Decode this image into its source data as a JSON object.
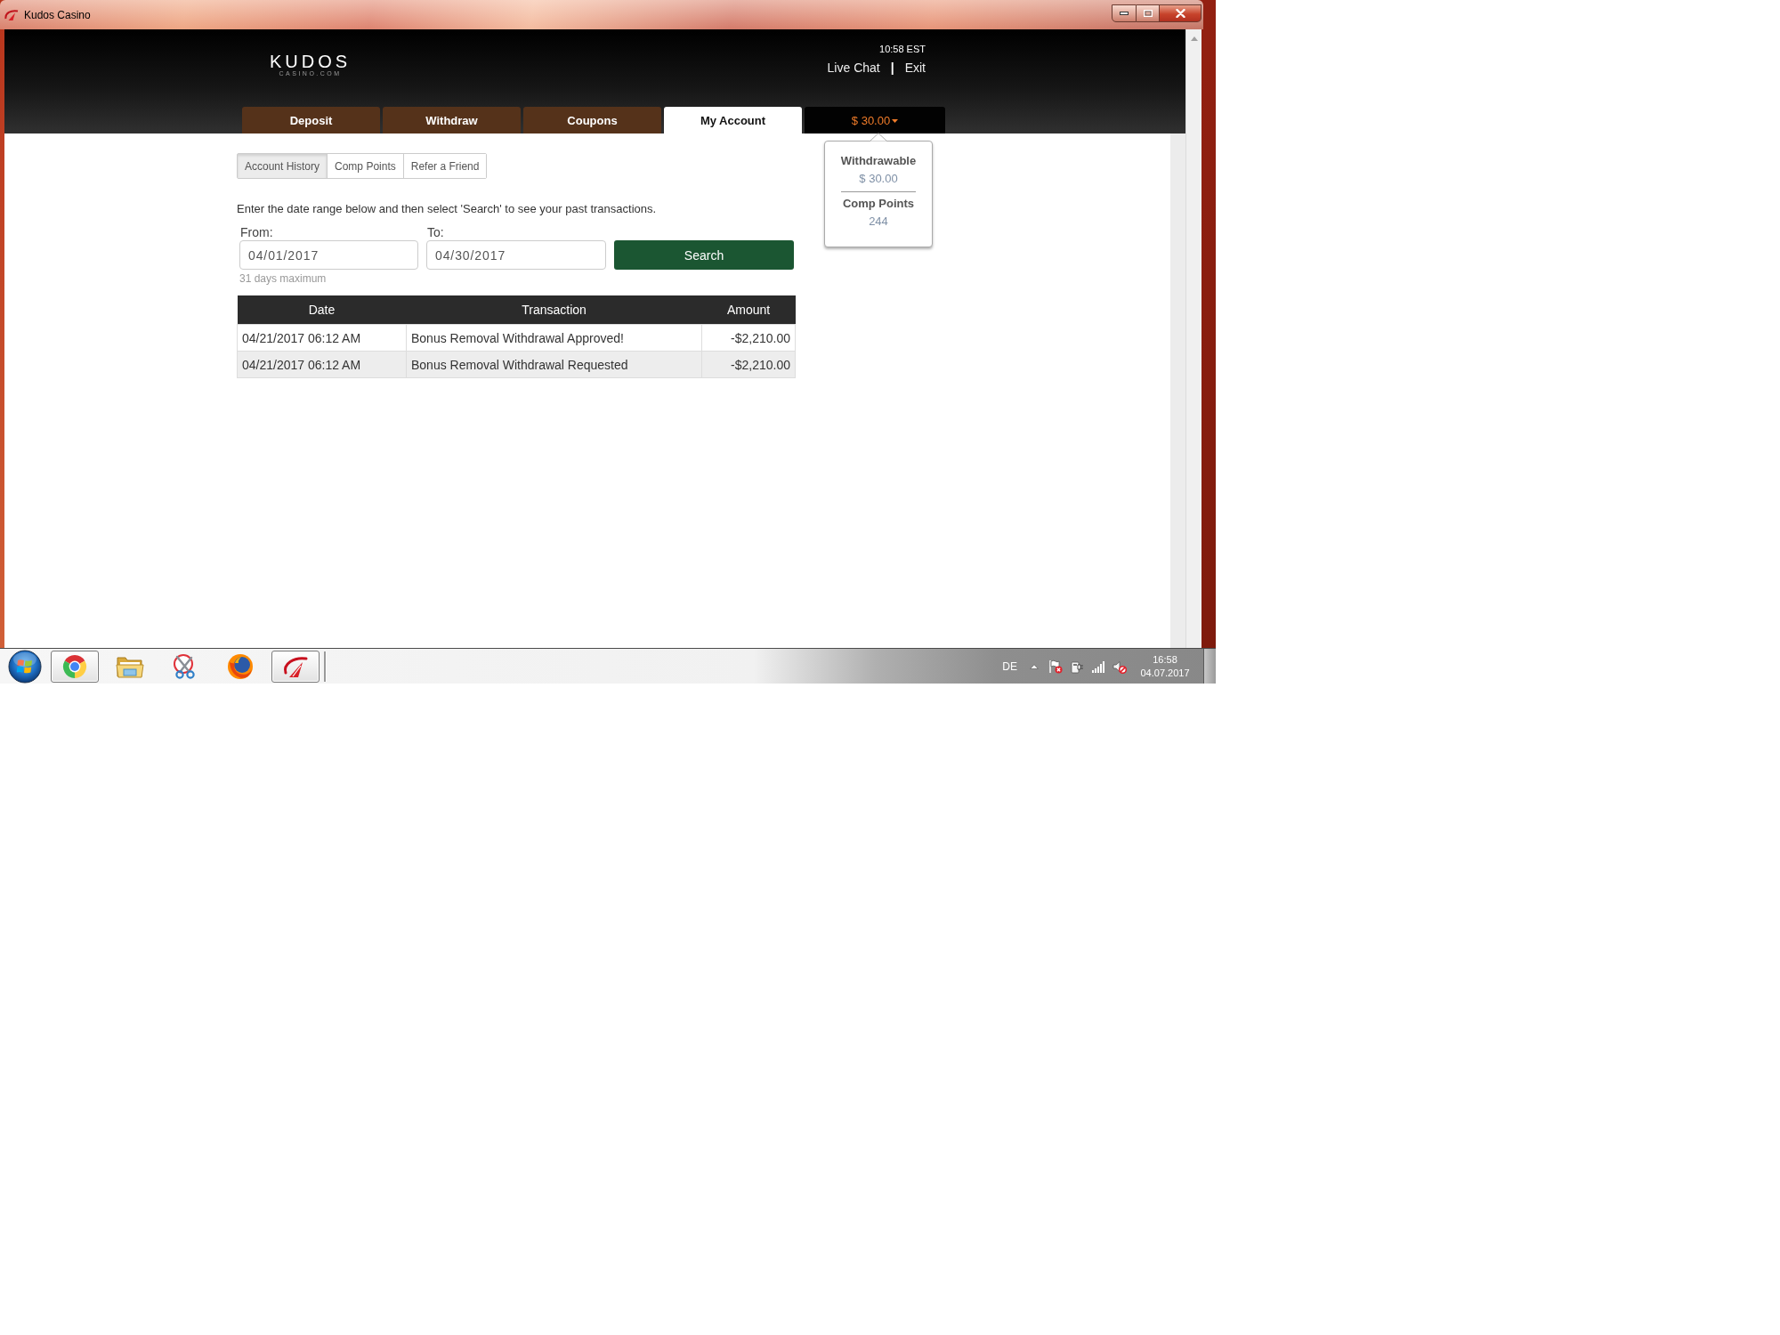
{
  "window": {
    "title": "Kudos Casino"
  },
  "header": {
    "logo": {
      "name": "KUDOS",
      "tagline": "CASINO.COM"
    },
    "clock": "10:58 EST",
    "links": [
      "Live Chat",
      "Exit"
    ],
    "separator": "|"
  },
  "nav_tabs": [
    {
      "label": "Deposit",
      "selected": false
    },
    {
      "label": "Withdraw",
      "selected": false
    },
    {
      "label": "Coupons",
      "selected": false
    },
    {
      "label": "My Account",
      "selected": true
    }
  ],
  "balance": {
    "amount": "$ 30.00",
    "expanded": true,
    "popup": [
      {
        "label": "Withdrawable",
        "value": "$ 30.00"
      },
      {
        "label": "Comp Points",
        "value": "244"
      }
    ]
  },
  "sub_tabs": [
    {
      "label": "Account History",
      "selected": true
    },
    {
      "label": "Comp Points",
      "selected": false
    },
    {
      "label": "Refer a Friend",
      "selected": false
    }
  ],
  "instructions": "Enter the date range below and then select 'Search' to see your past transactions.",
  "date_range": {
    "from_label": "From:",
    "from_value": "04/01/2017",
    "to_label": "To:",
    "to_value": "04/30/2017",
    "hint": "31 days maximum",
    "button": "Search"
  },
  "table": {
    "columns": [
      "Date",
      "Transaction",
      "Amount"
    ],
    "rows": [
      [
        "04/21/2017 06:12 AM",
        "Bonus Removal Withdrawal Approved!",
        "-$2,210.00"
      ],
      [
        "04/21/2017 06:12 AM",
        "Bonus Removal Withdrawal Requested",
        "-$2,210.00"
      ]
    ]
  },
  "taskbar": {
    "apps": [
      {
        "kind": "chrome",
        "running": true
      },
      {
        "kind": "folder",
        "running": false
      },
      {
        "kind": "scissors",
        "running": false
      },
      {
        "kind": "firefox",
        "running": false
      },
      {
        "kind": "kudos",
        "running": true
      }
    ],
    "language": "DE",
    "time": "16:58",
    "date": "04.07.2017"
  }
}
